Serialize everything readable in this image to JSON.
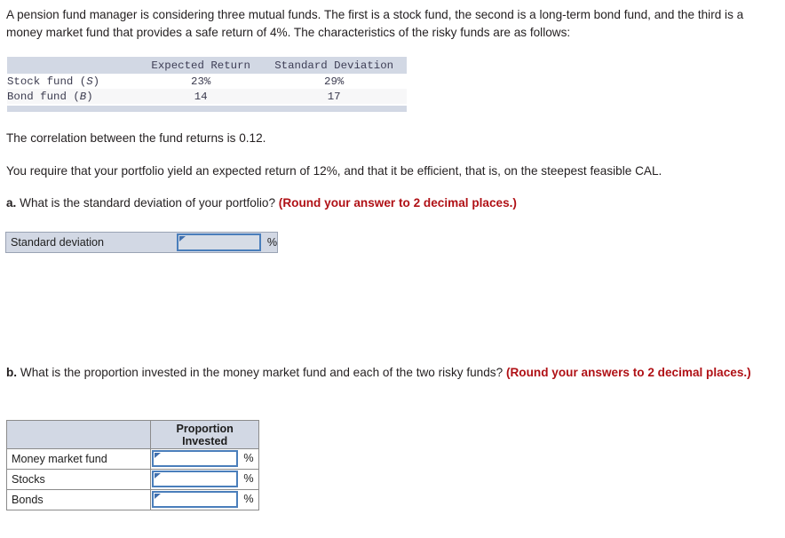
{
  "intro": {
    "paragraph": "A pension fund manager is considering three mutual funds. The first is a stock fund, the second is a long-term bond fund, and the third is a money market fund that provides a safe return of 4%. The characteristics of the risky funds are as follows:"
  },
  "fund_table": {
    "columns": [
      "",
      "Expected Return",
      "Standard Deviation"
    ],
    "rows": [
      {
        "name": "Stock fund (",
        "symbol": "S",
        "name_end": ")",
        "expected_return": "23%",
        "std_dev": "29%"
      },
      {
        "name": "Bond fund (",
        "symbol": "B",
        "name_end": ")",
        "expected_return": "14",
        "std_dev": "17"
      }
    ]
  },
  "correlation_line": "The correlation between the fund returns is 0.12.",
  "requirement_line": "You require that your portfolio yield an expected return of 12%, and that it be efficient, that is, on the steepest feasible CAL.",
  "question_a": {
    "marker": "a.",
    "text": " What is the standard deviation of your portfolio? ",
    "instruction": "(Round your answer to 2 decimal places.)"
  },
  "answer_a": {
    "label": "Standard deviation",
    "value": "",
    "placeholder": "",
    "unit": "%"
  },
  "question_b": {
    "marker": "b.",
    "text": " What is the proportion invested in the money market fund and each of the two risky funds? ",
    "instruction": "(Round your answers to 2 decimal places.)"
  },
  "answer_b": {
    "header_blank": "",
    "header_proportion_line1": "Proportion",
    "header_proportion_line2": "Invested",
    "rows": [
      {
        "label": "Money market fund",
        "value": "",
        "unit": "%"
      },
      {
        "label": "Stocks",
        "value": "",
        "unit": "%"
      },
      {
        "label": "Bonds",
        "value": "",
        "unit": "%"
      }
    ]
  },
  "colors": {
    "header_bg": "#d2d8e4",
    "input_border": "#4a7ebb",
    "instruction_red": "#b01116",
    "text": "#231f20"
  }
}
